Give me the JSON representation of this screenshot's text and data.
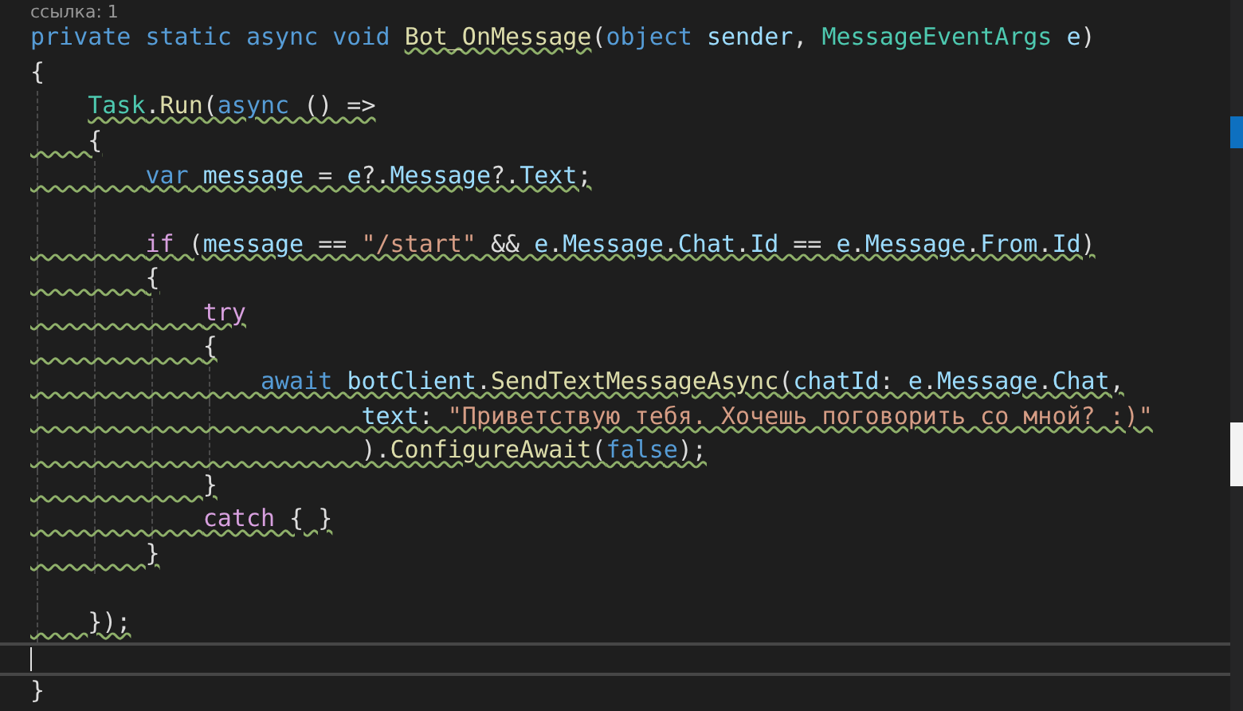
{
  "codelens": "ссылка: 1",
  "lines": [
    {
      "kind": "code",
      "squiggle_from_margin": false,
      "tokens": [
        {
          "t": "private",
          "kind": "keyword"
        },
        {
          "t": " static",
          "kind": "keyword"
        },
        {
          "t": " async",
          "kind": "keyword"
        },
        {
          "t": " void ",
          "kind": "keyword"
        },
        {
          "t": "Bot_OnMessage",
          "kind": "method",
          "squiggle": true
        },
        {
          "t": "("
        },
        {
          "t": "object ",
          "kind": "keyword"
        },
        {
          "t": "sender",
          "kind": "variable"
        },
        {
          "t": ", "
        },
        {
          "t": "MessageEventArgs ",
          "kind": "type"
        },
        {
          "t": "e",
          "kind": "variable"
        },
        {
          "t": ")"
        }
      ]
    },
    {
      "kind": "code",
      "squiggle_from_margin": false,
      "tokens": [
        {
          "t": "{"
        }
      ]
    },
    {
      "kind": "code",
      "squiggle_from_margin": false,
      "tokens": [
        {
          "t": "    Task",
          "kind": "type",
          "squiggle": true
        },
        {
          "t": ".",
          "squiggle": true
        },
        {
          "t": "Run",
          "kind": "method",
          "squiggle": true
        },
        {
          "t": "(",
          "squiggle": true
        },
        {
          "t": "async",
          "kind": "keyword",
          "squiggle": true
        },
        {
          "t": " () =>",
          "squiggle": true
        }
      ]
    },
    {
      "kind": "code",
      "squiggle_from_margin": true,
      "tokens": [
        {
          "t": "    {"
        }
      ]
    },
    {
      "kind": "code",
      "squiggle_from_margin": true,
      "tokens": [
        {
          "t": "        var ",
          "kind": "keyword"
        },
        {
          "t": "message",
          "kind": "variable"
        },
        {
          "t": " = "
        },
        {
          "t": "e",
          "kind": "variable"
        },
        {
          "t": "?."
        },
        {
          "t": "Message",
          "kind": "variable"
        },
        {
          "t": "?."
        },
        {
          "t": "Text",
          "kind": "variable"
        },
        {
          "t": ";"
        }
      ]
    },
    {
      "kind": "blank"
    },
    {
      "kind": "code",
      "squiggle_from_margin": true,
      "tokens": [
        {
          "t": "        if",
          "kind": "control"
        },
        {
          "t": " ("
        },
        {
          "t": "message",
          "kind": "variable"
        },
        {
          "t": " == "
        },
        {
          "t": "\"/start\"",
          "kind": "string"
        },
        {
          "t": " && "
        },
        {
          "t": "e",
          "kind": "variable"
        },
        {
          "t": "."
        },
        {
          "t": "Message",
          "kind": "variable"
        },
        {
          "t": "."
        },
        {
          "t": "Chat",
          "kind": "variable"
        },
        {
          "t": "."
        },
        {
          "t": "Id",
          "kind": "variable"
        },
        {
          "t": " == "
        },
        {
          "t": "e",
          "kind": "variable"
        },
        {
          "t": "."
        },
        {
          "t": "Message",
          "kind": "variable"
        },
        {
          "t": "."
        },
        {
          "t": "From",
          "kind": "variable"
        },
        {
          "t": "."
        },
        {
          "t": "Id",
          "kind": "variable"
        },
        {
          "t": ")"
        }
      ]
    },
    {
      "kind": "code",
      "squiggle_from_margin": true,
      "tokens": [
        {
          "t": "        {"
        }
      ]
    },
    {
      "kind": "code",
      "squiggle_from_margin": true,
      "tokens": [
        {
          "t": "            try",
          "kind": "control"
        }
      ]
    },
    {
      "kind": "code",
      "squiggle_from_margin": true,
      "tokens": [
        {
          "t": "            {"
        }
      ]
    },
    {
      "kind": "code",
      "squiggle_from_margin": true,
      "tokens": [
        {
          "t": "                await ",
          "kind": "keyword"
        },
        {
          "t": "botClient",
          "kind": "variable"
        },
        {
          "t": "."
        },
        {
          "t": "SendTextMessageAsync",
          "kind": "method"
        },
        {
          "t": "("
        },
        {
          "t": "chatId",
          "kind": "variable"
        },
        {
          "t": ": "
        },
        {
          "t": "e",
          "kind": "variable"
        },
        {
          "t": "."
        },
        {
          "t": "Message",
          "kind": "variable"
        },
        {
          "t": "."
        },
        {
          "t": "Chat",
          "kind": "variable"
        },
        {
          "t": ","
        }
      ]
    },
    {
      "kind": "code",
      "squiggle_from_margin": true,
      "tokens": [
        {
          "t": "                       text",
          "kind": "variable"
        },
        {
          "t": ": "
        },
        {
          "t": "\"Приветствую тебя. Хочешь поговорить со мной? :)\"",
          "kind": "string"
        }
      ]
    },
    {
      "kind": "code",
      "squiggle_from_margin": true,
      "tokens": [
        {
          "t": "                       )."
        },
        {
          "t": "ConfigureAwait",
          "kind": "method"
        },
        {
          "t": "("
        },
        {
          "t": "false",
          "kind": "keyword"
        },
        {
          "t": ");"
        }
      ]
    },
    {
      "kind": "code",
      "squiggle_from_margin": true,
      "tokens": [
        {
          "t": "            }"
        }
      ]
    },
    {
      "kind": "code",
      "squiggle_from_margin": true,
      "tokens": [
        {
          "t": "            catch",
          "kind": "control"
        },
        {
          "t": " { }"
        }
      ]
    },
    {
      "kind": "code",
      "squiggle_from_margin": true,
      "tokens": [
        {
          "t": "        }"
        }
      ]
    },
    {
      "kind": "blank"
    },
    {
      "kind": "code",
      "squiggle_from_margin": true,
      "tokens": [
        {
          "t": "    });"
        }
      ]
    },
    {
      "kind": "cursor"
    },
    {
      "kind": "code",
      "squiggle_from_margin": false,
      "tokens": [
        {
          "t": "}"
        }
      ]
    }
  ]
}
